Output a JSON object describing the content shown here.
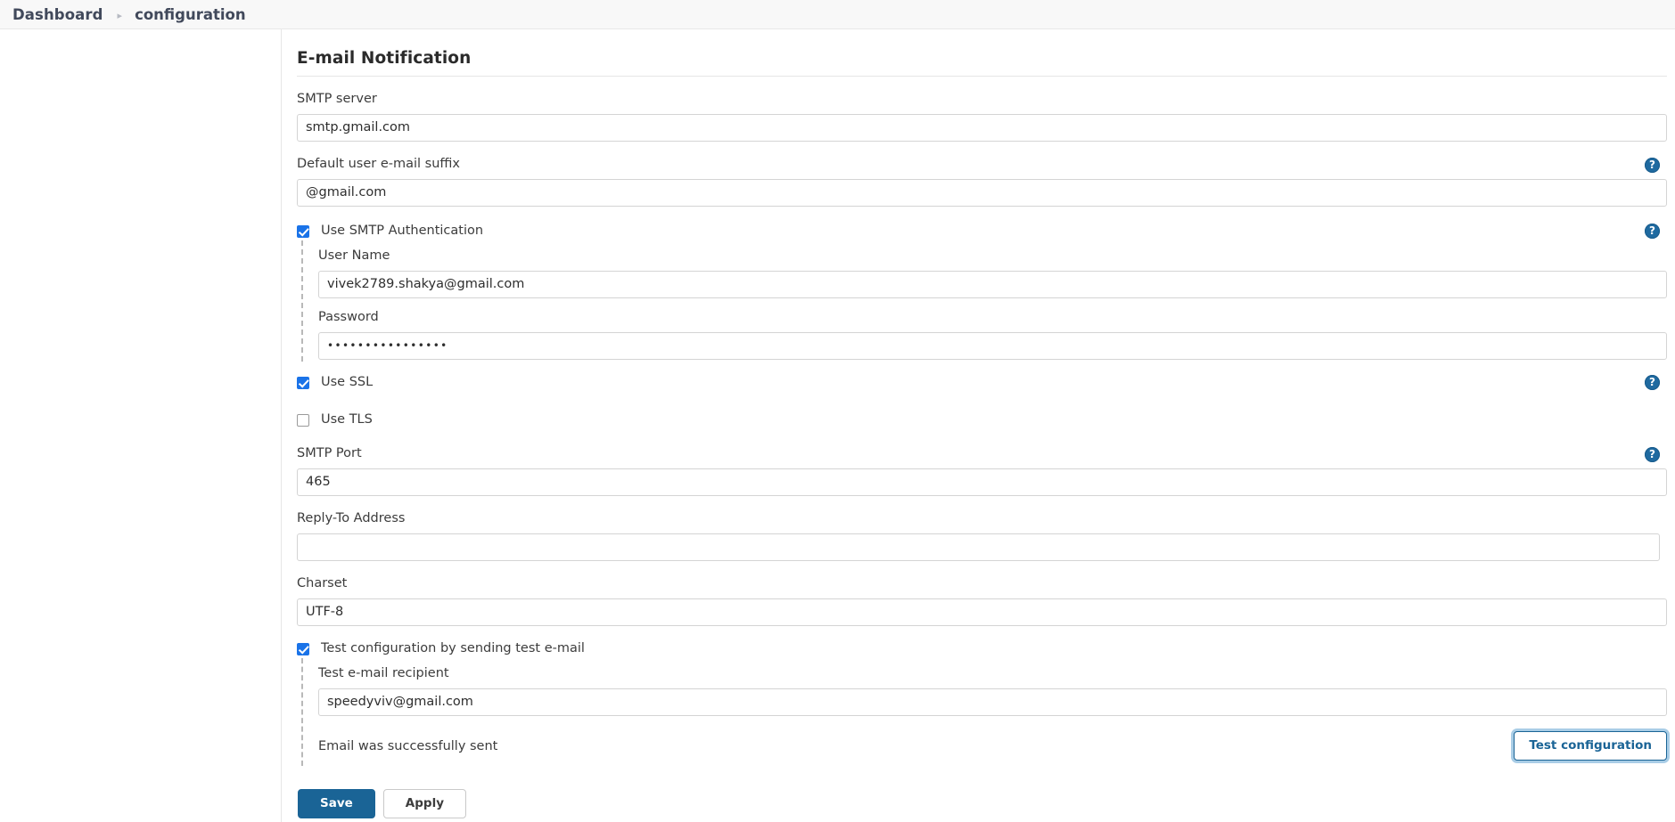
{
  "breadcrumb": {
    "root": "Dashboard",
    "separator": "▸",
    "current": "configuration"
  },
  "section": {
    "title": "E-mail Notification"
  },
  "help_icon_glyph": "?",
  "fields": {
    "smtp_server": {
      "label": "SMTP server",
      "value": "smtp.gmail.com",
      "placeholder": ""
    },
    "email_suffix": {
      "label": "Default user e-mail suffix",
      "value": "@gmail.com",
      "placeholder": "",
      "help": "?"
    },
    "use_smtp_auth": {
      "label": "Use SMTP Authentication",
      "checked": true,
      "help": "?"
    },
    "user_name": {
      "label": "User Name",
      "value": "vivek2789.shakya@gmail.com",
      "placeholder": ""
    },
    "password": {
      "label": "Password",
      "value": "••••••••••••••••",
      "placeholder": ""
    },
    "use_ssl": {
      "label": "Use SSL",
      "checked": true,
      "help": "?"
    },
    "use_tls": {
      "label": "Use TLS",
      "checked": false
    },
    "smtp_port": {
      "label": "SMTP Port",
      "value": "465",
      "placeholder": "",
      "help": "?"
    },
    "reply_to": {
      "label": "Reply-To Address",
      "value": "",
      "placeholder": ""
    },
    "charset": {
      "label": "Charset",
      "value": "UTF-8",
      "placeholder": ""
    },
    "test_config": {
      "label": "Test configuration by sending test e-mail",
      "checked": true
    },
    "test_recipient": {
      "label": "Test e-mail recipient",
      "value": "speedyviv@gmail.com",
      "placeholder": ""
    }
  },
  "status": {
    "message": "Email was successfully sent"
  },
  "buttons": {
    "test_configuration": "Test configuration",
    "save": "Save",
    "apply": "Apply"
  },
  "colors": {
    "accent_blue": "#1a6496",
    "checkbox_blue": "#1a73e8",
    "help_icon_blue": "#1f6aa0",
    "focus_ring": "#a9cde6",
    "breadcrumb_bg": "#f8f8f8",
    "text": "#3c3c3c",
    "border": "#d4d4d4"
  }
}
